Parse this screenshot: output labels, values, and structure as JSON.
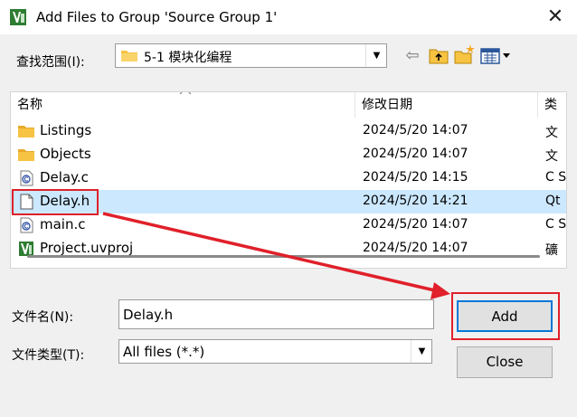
{
  "window": {
    "title": "Add Files to Group 'Source Group 1'",
    "close_glyph": "✕"
  },
  "toolbar": {
    "look_in_label": "查找范围(I):",
    "look_in_value": "5-1 模块化编程",
    "back_glyph": "⇦"
  },
  "file_list": {
    "columns": {
      "name": "名称",
      "date": "修改日期",
      "type": "类"
    },
    "rows": [
      {
        "name": "Listings",
        "date": "2024/5/20 14:07",
        "type": "文",
        "icon": "folder-icon",
        "selected": false
      },
      {
        "name": "Objects",
        "date": "2024/5/20 14:07",
        "type": "文",
        "icon": "folder-icon",
        "selected": false
      },
      {
        "name": "Delay.c",
        "date": "2024/5/20 14:15",
        "type": "C S",
        "icon": "c-file-icon",
        "selected": false
      },
      {
        "name": "Delay.h",
        "date": "2024/5/20 14:21",
        "type": "Qt",
        "icon": "header-file-icon",
        "selected": true
      },
      {
        "name": "main.c",
        "date": "2024/5/20 14:07",
        "type": "C S",
        "icon": "c-file-icon",
        "selected": false
      },
      {
        "name": "Project.uvproj",
        "date": "2024/5/20 14:07",
        "type": "礦",
        "icon": "uvproj-icon",
        "selected": false
      }
    ]
  },
  "form": {
    "filename_label": "文件名(N):",
    "filename_value": "Delay.h",
    "filetype_label": "文件类型(T):",
    "filetype_value": "All files (*.*)"
  },
  "buttons": {
    "add": "Add",
    "close": "Close"
  },
  "colors": {
    "selection": "#cce8ff",
    "annotation": "#e0202a",
    "folder": "#f6c342"
  }
}
